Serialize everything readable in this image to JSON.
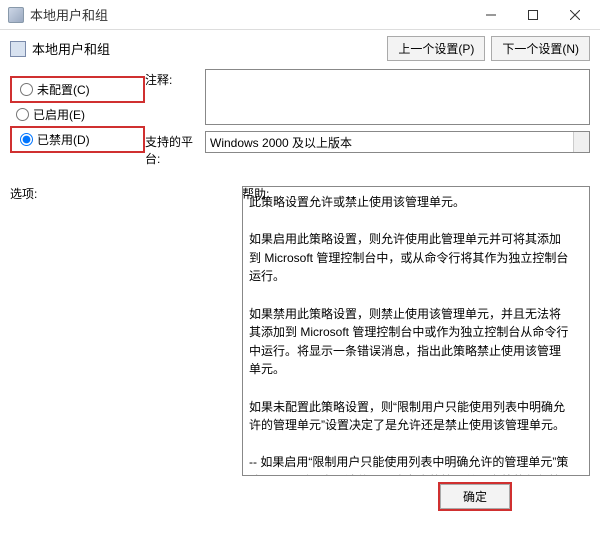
{
  "window": {
    "title": "本地用户和组"
  },
  "header": {
    "title": "本地用户和组",
    "prev": "上一个设置(P)",
    "next": "下一个设置(N)"
  },
  "radios": {
    "not_configured": "未配置(C)",
    "enabled": "已启用(E)",
    "disabled": "已禁用(D)"
  },
  "fields": {
    "comment_label": "注释:",
    "comment_value": "",
    "platform_label": "支持的平台:",
    "platform_value": "Windows 2000 及以上版本"
  },
  "lower": {
    "options_label": "选项:",
    "help_label": "帮助:",
    "help_text": "此策略设置允许或禁止使用该管理单元。\n\n如果启用此策略设置，则允许使用此管理单元并可将其添加到 Microsoft 管理控制台中，或从命令行将其作为独立控制台运行。\n\n如果禁用此策略设置，则禁止使用该管理单元，并且无法将其添加到 Microsoft 管理控制台中或作为独立控制台从命令行中运行。将显示一条错误消息，指出此策略禁止使用该管理单元。\n\n如果未配置此策略设置，则“限制用户只能使用列表中明确允许的管理单元”设置决定了是允许还是禁止使用该管理单元。\n\n-- 如果启用“限制用户只能使用列表中明确允许的管理单元”策略设置，则用户无法使用明确允许的管理单元之外的任何管理单元。要明确允许使用该管理单元，请启用此策略设置。如果未配置或禁用此策略设置，则禁止使用此管理单元。\n\n-- 如果禁用或未配置策略设置“限制用户只能使用列表中明确允许的管理单元”，则用户可以使用除了明确禁止的管理单元之外的任何管理单元。"
  },
  "footer": {
    "ok": "确定"
  }
}
